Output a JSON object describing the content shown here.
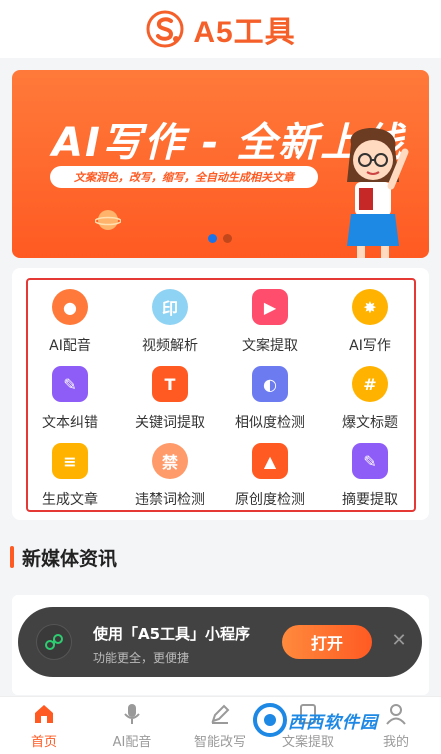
{
  "header": {
    "app_name": "A5工具"
  },
  "banner": {
    "title": "AI写作 - 全新上线",
    "subtitle": "文案润色，改写，缩写，全自动生成相关文章",
    "dots_active_index": 0,
    "dots_count": 2
  },
  "tools": [
    {
      "label": "AI配音",
      "icon": "microphone-icon",
      "color": "#ff7a3a"
    },
    {
      "label": "视频解析",
      "icon": "video-parse-icon",
      "color": "#8fd3f4"
    },
    {
      "label": "文案提取",
      "icon": "video-play-icon",
      "color": "#ff4d6d"
    },
    {
      "label": "AI写作",
      "icon": "sparkle-icon",
      "color": "#ffb300"
    },
    {
      "label": "文本纠错",
      "icon": "edit-doc-icon",
      "color": "#8e5cf7"
    },
    {
      "label": "关键词提取",
      "icon": "text-search-icon",
      "color": "#ff5a22"
    },
    {
      "label": "相似度检测",
      "icon": "overlap-icon",
      "color": "#6c7cf0"
    },
    {
      "label": "爆文标题",
      "icon": "hashtag-icon",
      "color": "#ffb300"
    },
    {
      "label": "生成文章",
      "icon": "document-icon",
      "color": "#ffb300"
    },
    {
      "label": "违禁词检测",
      "icon": "forbidden-word-icon",
      "color": "#ff9a6a"
    },
    {
      "label": "原创度检测",
      "icon": "flask-icon",
      "color": "#ff5a22"
    },
    {
      "label": "摘要提取",
      "icon": "summary-icon",
      "color": "#8e5cf7"
    }
  ],
  "news_section": {
    "title": "新媒体资讯"
  },
  "toast": {
    "title": "使用「A5工具」小程序",
    "subtitle": "功能更全，更便捷",
    "open_label": "打开",
    "close_icon": "close-icon"
  },
  "tabbar": [
    {
      "label": "首页",
      "icon": "home-icon",
      "active": true
    },
    {
      "label": "AI配音",
      "icon": "microphone-icon",
      "active": false
    },
    {
      "label": "智能改写",
      "icon": "pen-icon",
      "active": false
    },
    {
      "label": "文案提取",
      "icon": "document-icon",
      "active": false
    },
    {
      "label": "我的",
      "icon": "user-icon",
      "active": false
    }
  ],
  "watermark": {
    "text": "西西软件园"
  },
  "colors": {
    "brand": "#ff5a22",
    "highlight_frame": "#e53935",
    "dot_active": "#1a73e8"
  }
}
